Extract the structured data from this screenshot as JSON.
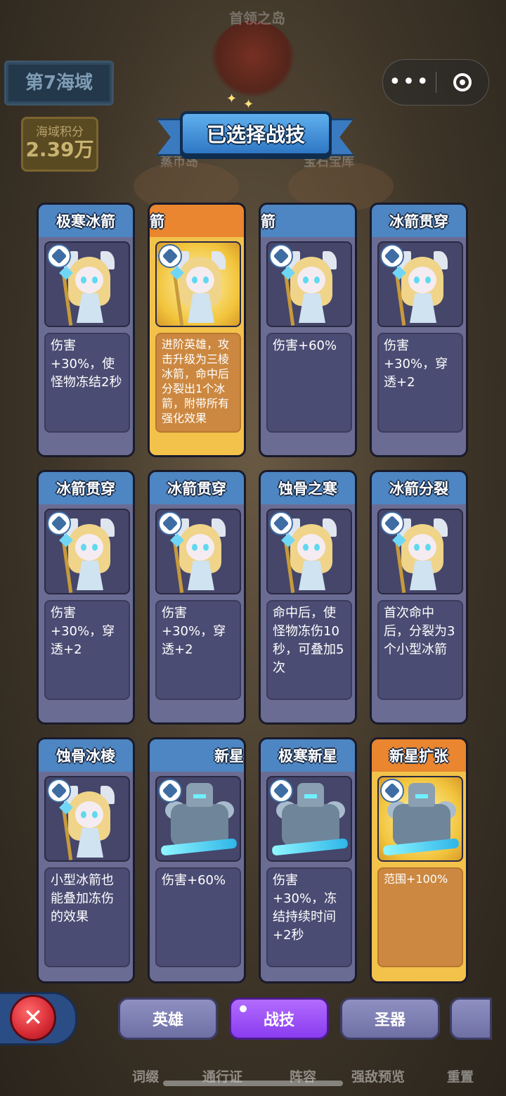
{
  "background": {
    "boss_island_label": "首领之岛",
    "left_island_label": "蒸币岛",
    "right_island_label": "宝石宝库",
    "region_label": "第7海域",
    "score_label": "海域积分",
    "score_value": "2.39万"
  },
  "capsule": {
    "more_label": "•••",
    "target_icon": "target-icon"
  },
  "title": "已选择战技",
  "cards": [
    {
      "name": "极寒冰箭",
      "desc": "伤害+30%，使怪物冻结2秒",
      "portrait": "ice-archer",
      "style": "normal"
    },
    {
      "name": "箭",
      "desc": "进阶英雄，攻击升级为三棱冰箭，命中后分裂出1个冰箭，附带所有强化效果",
      "portrait": "ice-archer",
      "style": "gold"
    },
    {
      "name": "箭",
      "desc": "伤害+60%",
      "portrait": "ice-archer",
      "style": "normal"
    },
    {
      "name": "冰箭贯穿",
      "desc": "伤害+30%，穿透+2",
      "portrait": "ice-archer",
      "style": "normal"
    },
    {
      "name": "冰箭贯穿",
      "desc": "伤害+30%，穿透+2",
      "portrait": "ice-archer",
      "style": "normal"
    },
    {
      "name": "冰箭贯穿",
      "desc": "伤害+30%，穿透+2",
      "portrait": "ice-archer",
      "style": "normal"
    },
    {
      "name": "蚀骨之寒",
      "desc": "命中后，使怪物冻伤10秒，可叠加5次",
      "portrait": "ice-archer",
      "style": "normal"
    },
    {
      "name": "冰箭分裂",
      "desc": "首次命中后，分裂为3个小型冰箭",
      "portrait": "ice-archer",
      "style": "normal"
    },
    {
      "name": "蚀骨冰棱",
      "desc": "小型冰箭也能叠加冻伤的效果",
      "portrait": "ice-archer",
      "style": "normal"
    },
    {
      "name": "新星",
      "desc": "伤害+60%",
      "portrait": "frost-knight",
      "style": "normal"
    },
    {
      "name": "极寒新星",
      "desc": "伤害+30%，冻结持续时间+2秒",
      "portrait": "frost-knight",
      "style": "normal"
    },
    {
      "name": "新星扩张",
      "desc": "范围+100%",
      "portrait": "frost-knight",
      "style": "gold"
    }
  ],
  "tabs": [
    {
      "label": "英雄"
    },
    {
      "label": "战技"
    },
    {
      "label": "圣器"
    }
  ],
  "footer": [
    "词缀",
    "通行证",
    "阵容",
    "强敌预览",
    "重置"
  ]
}
